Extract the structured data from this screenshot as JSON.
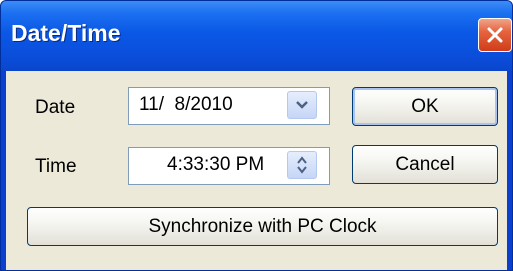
{
  "window": {
    "title": "Date/Time",
    "close_icon": "close-icon"
  },
  "form": {
    "date_label": "Date",
    "date_value": "11/  8/2010",
    "date_dropdown_icon": "chevron-down-icon",
    "time_label": "Time",
    "time_value": "4:33:30 PM",
    "time_spinner_icon": "up-down-arrows-icon"
  },
  "buttons": {
    "ok_label": "OK",
    "cancel_label": "Cancel",
    "sync_label": "Synchronize with PC Clock"
  },
  "colors": {
    "title_bar": "#0a4fdc",
    "close_button": "#e5633e",
    "dialog_background": "#ece9d8",
    "field_border": "#7f9db9",
    "button_border": "#003c74"
  }
}
